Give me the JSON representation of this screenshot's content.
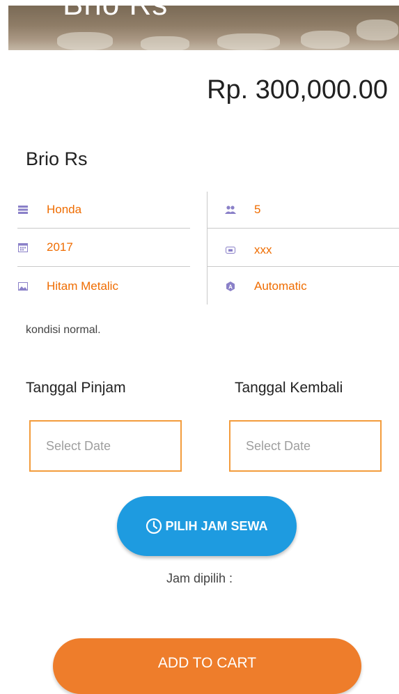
{
  "hero": {
    "title": "Brio Rs"
  },
  "price": "Rp. 300,000.00",
  "car_name": "Brio Rs",
  "specs": [
    {
      "icon": "list-icon",
      "value": "Honda"
    },
    {
      "icon": "seats-icon",
      "value": "5"
    },
    {
      "icon": "calendar-icon",
      "value": "2017"
    },
    {
      "icon": "plate-icon",
      "value": "xxx"
    },
    {
      "icon": "color-icon",
      "value": "Hitam Metalic"
    },
    {
      "icon": "transmission-icon",
      "value": "Automatic"
    }
  ],
  "description": "kondisi normal.",
  "dates": {
    "pinjam_label": "Tanggal Pinjam",
    "kembali_label": "Tanggal Kembali",
    "pinjam_placeholder": "Select Date",
    "kembali_placeholder": "Select Date"
  },
  "jam": {
    "button_label": "PILIH JAM SEWA",
    "selected_label": "Jam dipilih :"
  },
  "cart": {
    "button_label": "ADD TO CART"
  },
  "colors": {
    "accent_orange": "#ee7d2b",
    "spec_text": "#ef6c00",
    "button_blue": "#1e9be0",
    "icon_purple": "#8a80c8"
  }
}
